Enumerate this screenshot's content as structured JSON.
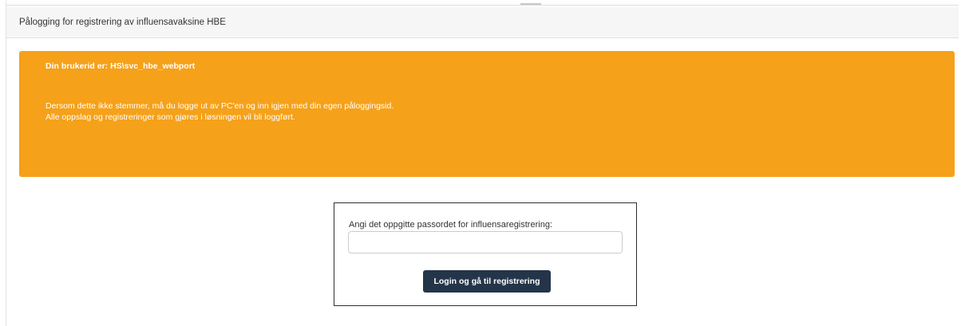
{
  "header": {
    "title": "Pålogging for registrering av influensavaksine HBE"
  },
  "alert": {
    "user_line": "Din brukerid er: HS\\svc_hbe_webport",
    "message_line_1": "Dersom dette ikke stemmer, må du logge ut av PC'en og inn igjen med din egen påloggingsid.",
    "message_line_2": "Alle oppslag og registreringer som gjøres i løsningen vil bli loggført.",
    "color": "#f5a11a"
  },
  "login": {
    "label": "Angi det oppgitte passordet for influensaregistrering:",
    "password_value": "",
    "password_placeholder": "",
    "button_label": "Login og gå til registrering",
    "button_color": "#253549"
  }
}
